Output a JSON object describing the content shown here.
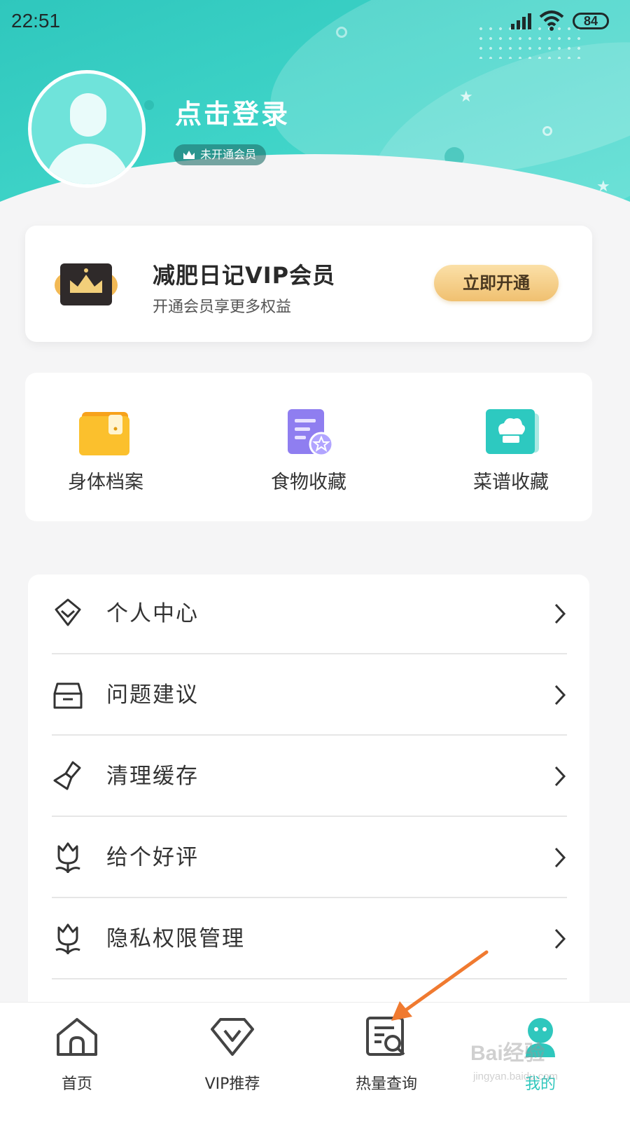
{
  "status_bar": {
    "time": "22:51",
    "battery": "84"
  },
  "profile": {
    "login_text": "点击登录",
    "member_status": "未开通会员"
  },
  "vip_card": {
    "title": "减肥日记VIP会员",
    "subtitle": "开通会员享更多权益",
    "button_label": "立即开通"
  },
  "shortcuts": [
    {
      "label": "身体档案",
      "icon": "folder-icon"
    },
    {
      "label": "食物收藏",
      "icon": "document-star-icon"
    },
    {
      "label": "菜谱收藏",
      "icon": "chef-hat-icon"
    }
  ],
  "menu": [
    {
      "label": "个人中心",
      "icon": "diamond-icon"
    },
    {
      "label": "问题建议",
      "icon": "inbox-icon"
    },
    {
      "label": "清理缓存",
      "icon": "brush-icon"
    },
    {
      "label": "给个好评",
      "icon": "tulip-icon"
    },
    {
      "label": "隐私权限管理",
      "icon": "tulip-icon"
    }
  ],
  "bottom_nav": [
    {
      "label": "首页",
      "icon": "home-icon"
    },
    {
      "label": "VIP推荐",
      "icon": "vip-icon"
    },
    {
      "label": "热量查询",
      "icon": "calorie-search-icon"
    },
    {
      "label": "我的",
      "icon": "profile-icon",
      "active": true
    }
  ],
  "watermark": {
    "main": "Bai经验",
    "sub": "jingyan.baidu.com"
  },
  "colors": {
    "accent": "#2fc7bd",
    "vip_button": "#f0c070",
    "arrow": "#f07a30"
  }
}
